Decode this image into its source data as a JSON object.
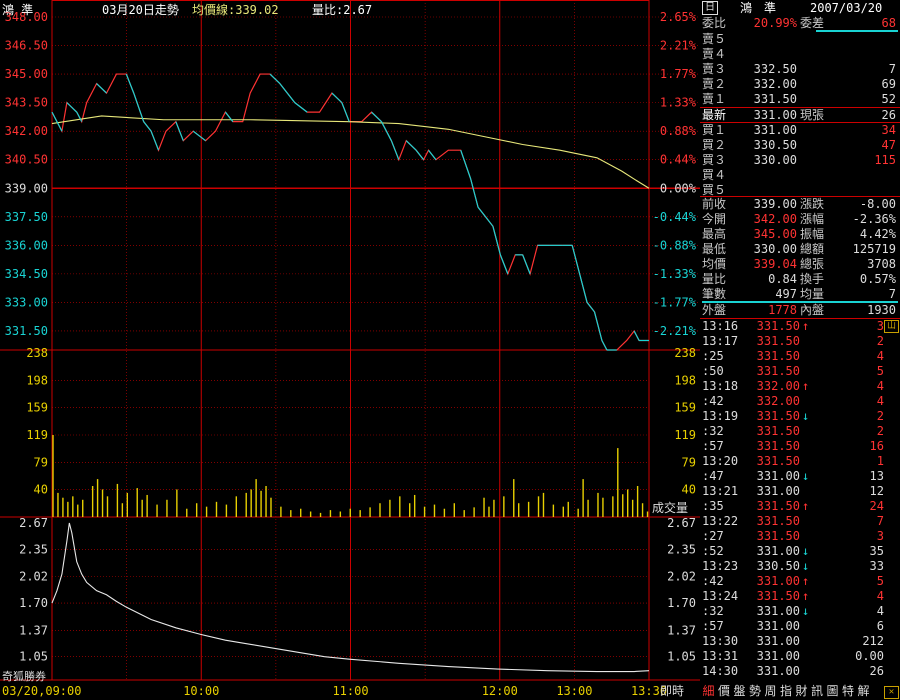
{
  "header": {
    "stock_name": "鴻 準",
    "date_label": "03月20日走勢",
    "avg_label": "均價線:339.02",
    "ratio_label": "量比:2.67"
  },
  "panel_icon": "日",
  "volume_label": "成交量",
  "time_label": "即時",
  "brand_label": "奇狐勝券",
  "chart_data": {
    "type": "line",
    "price_ticks": [
      "348.00",
      "346.50",
      "345.00",
      "343.50",
      "342.00",
      "340.50",
      "339.00",
      "337.50",
      "336.00",
      "334.50",
      "333.00",
      "331.50"
    ],
    "pct_ticks": [
      "2.65%",
      "2.21%",
      "1.77%",
      "1.33%",
      "0.88%",
      "0.44%",
      "0.00%",
      "-0.44%",
      "-0.88%",
      "-1.33%",
      "-1.77%",
      "-2.21%"
    ],
    "price_range": [
      330.5,
      348.0
    ],
    "prev_close": 339.0,
    "volume_ticks": [
      "238",
      "198",
      "159",
      "119",
      "79",
      "40"
    ],
    "volume_max": 238,
    "ratio_ticks": [
      "2.67",
      "2.35",
      "2.02",
      "1.70",
      "1.37",
      "1.05"
    ],
    "ratio_range": [
      0.84,
      2.67
    ],
    "x_ticks": [
      "03/20,09:00",
      "10:00",
      "11:00",
      "12:00",
      "13:00",
      "13:30"
    ],
    "price_series": [
      [
        0,
        343.0
      ],
      [
        4,
        342.0
      ],
      [
        6,
        343.5
      ],
      [
        10,
        343.0
      ],
      [
        12,
        342.5
      ],
      [
        14,
        343.5
      ],
      [
        18,
        344.5
      ],
      [
        22,
        344.0
      ],
      [
        26,
        345.0
      ],
      [
        30,
        345.0
      ],
      [
        33,
        344.0
      ],
      [
        37,
        342.5
      ],
      [
        40,
        342.0
      ],
      [
        43,
        341.0
      ],
      [
        46,
        342.0
      ],
      [
        50,
        342.5
      ],
      [
        53,
        341.5
      ],
      [
        57,
        342.0
      ],
      [
        62,
        341.5
      ],
      [
        66,
        342.0
      ],
      [
        70,
        343.0
      ],
      [
        73,
        342.5
      ],
      [
        77,
        342.5
      ],
      [
        80,
        344.0
      ],
      [
        84,
        345.0
      ],
      [
        88,
        345.0
      ],
      [
        92,
        344.5
      ],
      [
        95,
        344.0
      ],
      [
        98,
        343.5
      ],
      [
        103,
        343.0
      ],
      [
        108,
        343.0
      ],
      [
        113,
        344.0
      ],
      [
        117,
        343.5
      ],
      [
        120,
        342.5
      ],
      [
        125,
        342.5
      ],
      [
        129,
        343.0
      ],
      [
        133,
        342.5
      ],
      [
        137,
        341.5
      ],
      [
        140,
        340.5
      ],
      [
        143,
        341.5
      ],
      [
        147,
        341.0
      ],
      [
        150,
        340.5
      ],
      [
        152,
        341.0
      ],
      [
        155,
        340.5
      ],
      [
        160,
        341.0
      ],
      [
        165,
        341.0
      ],
      [
        169,
        339.5
      ],
      [
        172,
        338.0
      ],
      [
        175,
        337.5
      ],
      [
        178,
        337.0
      ],
      [
        181,
        335.5
      ],
      [
        184,
        334.5
      ],
      [
        187,
        335.5
      ],
      [
        190,
        335.5
      ],
      [
        193,
        334.5
      ],
      [
        196,
        336.0
      ],
      [
        201,
        336.0
      ],
      [
        206,
        336.0
      ],
      [
        210,
        336.0
      ],
      [
        213,
        334.5
      ],
      [
        216,
        333.0
      ],
      [
        219,
        332.5
      ],
      [
        222,
        331.0
      ],
      [
        224,
        330.5
      ],
      [
        228,
        330.5
      ],
      [
        232,
        331.0
      ],
      [
        235,
        331.5
      ],
      [
        237,
        331.0
      ],
      [
        240,
        331.0
      ],
      [
        241,
        331.0
      ]
    ],
    "avg_series": [
      [
        0,
        342.4
      ],
      [
        20,
        342.8
      ],
      [
        45,
        342.6
      ],
      [
        80,
        342.6
      ],
      [
        120,
        342.5
      ],
      [
        140,
        342.4
      ],
      [
        160,
        342.1
      ],
      [
        175,
        341.7
      ],
      [
        190,
        341.3
      ],
      [
        205,
        341.0
      ],
      [
        220,
        340.6
      ],
      [
        230,
        339.9
      ],
      [
        236,
        339.4
      ],
      [
        241,
        339.0
      ]
    ],
    "volume_series": [
      [
        0,
        119
      ],
      [
        2,
        35
      ],
      [
        4,
        28
      ],
      [
        6,
        22
      ],
      [
        8,
        30
      ],
      [
        10,
        18
      ],
      [
        12,
        25
      ],
      [
        16,
        45
      ],
      [
        18,
        55
      ],
      [
        20,
        40
      ],
      [
        22,
        30
      ],
      [
        26,
        48
      ],
      [
        28,
        20
      ],
      [
        30,
        35
      ],
      [
        34,
        42
      ],
      [
        36,
        25
      ],
      [
        38,
        32
      ],
      [
        42,
        18
      ],
      [
        46,
        25
      ],
      [
        50,
        40
      ],
      [
        54,
        12
      ],
      [
        58,
        20
      ],
      [
        62,
        15
      ],
      [
        66,
        22
      ],
      [
        70,
        18
      ],
      [
        74,
        30
      ],
      [
        78,
        35
      ],
      [
        80,
        40
      ],
      [
        82,
        55
      ],
      [
        84,
        38
      ],
      [
        86,
        45
      ],
      [
        88,
        28
      ],
      [
        92,
        15
      ],
      [
        96,
        10
      ],
      [
        100,
        12
      ],
      [
        104,
        8
      ],
      [
        108,
        6
      ],
      [
        112,
        10
      ],
      [
        116,
        8
      ],
      [
        120,
        12
      ],
      [
        124,
        10
      ],
      [
        128,
        14
      ],
      [
        132,
        20
      ],
      [
        136,
        25
      ],
      [
        140,
        30
      ],
      [
        144,
        20
      ],
      [
        146,
        32
      ],
      [
        150,
        15
      ],
      [
        154,
        18
      ],
      [
        158,
        12
      ],
      [
        162,
        20
      ],
      [
        166,
        10
      ],
      [
        170,
        14
      ],
      [
        174,
        28
      ],
      [
        176,
        15
      ],
      [
        178,
        25
      ],
      [
        182,
        30
      ],
      [
        186,
        55
      ],
      [
        188,
        20
      ],
      [
        192,
        22
      ],
      [
        196,
        30
      ],
      [
        198,
        35
      ],
      [
        202,
        18
      ],
      [
        206,
        15
      ],
      [
        208,
        22
      ],
      [
        212,
        12
      ],
      [
        214,
        55
      ],
      [
        216,
        25
      ],
      [
        220,
        35
      ],
      [
        222,
        28
      ],
      [
        226,
        30
      ],
      [
        228,
        100
      ],
      [
        230,
        33
      ],
      [
        232,
        40
      ],
      [
        234,
        25
      ],
      [
        236,
        45
      ],
      [
        238,
        20
      ],
      [
        240,
        8
      ]
    ],
    "ratio_series": [
      [
        0,
        1.7
      ],
      [
        2,
        1.85
      ],
      [
        4,
        2.05
      ],
      [
        6,
        2.45
      ],
      [
        7,
        2.67
      ],
      [
        8,
        2.55
      ],
      [
        10,
        2.2
      ],
      [
        12,
        2.05
      ],
      [
        14,
        1.95
      ],
      [
        18,
        1.85
      ],
      [
        22,
        1.8
      ],
      [
        26,
        1.72
      ],
      [
        30,
        1.65
      ],
      [
        40,
        1.5
      ],
      [
        50,
        1.4
      ],
      [
        60,
        1.32
      ],
      [
        70,
        1.25
      ],
      [
        80,
        1.2
      ],
      [
        90,
        1.15
      ],
      [
        100,
        1.1
      ],
      [
        110,
        1.05
      ],
      [
        120,
        1.02
      ],
      [
        140,
        0.97
      ],
      [
        160,
        0.93
      ],
      [
        180,
        0.9
      ],
      [
        200,
        0.88
      ],
      [
        220,
        0.87
      ],
      [
        235,
        0.87
      ],
      [
        241,
        0.88
      ]
    ]
  },
  "quote": {
    "title": "鴻　準",
    "date": "2007/03/20",
    "weibi_label": "委比",
    "weibi_value": "20.99%",
    "weicha_label": "委差",
    "weicha_value": "68",
    "asks": [
      {
        "label": "賣５",
        "price": "",
        "vol": ""
      },
      {
        "label": "賣４",
        "price": "",
        "vol": ""
      },
      {
        "label": "賣３",
        "price": "332.50",
        "vol": "7"
      },
      {
        "label": "賣２",
        "price": "332.00",
        "vol": "69"
      },
      {
        "label": "賣１",
        "price": "331.50",
        "vol": "52"
      }
    ],
    "last_label": "最新",
    "last_value": "331.00",
    "cur_label": "現張",
    "cur_value": "26",
    "bids": [
      {
        "label": "買１",
        "price": "331.00",
        "vol": "34"
      },
      {
        "label": "買２",
        "price": "330.50",
        "vol": "47"
      },
      {
        "label": "買３",
        "price": "330.00",
        "vol": "115"
      },
      {
        "label": "買４",
        "price": "",
        "vol": ""
      },
      {
        "label": "買５",
        "price": "",
        "vol": ""
      }
    ],
    "stats": [
      {
        "l1": "前收",
        "v1": "339.00",
        "c1": "#dddddd",
        "l2": "漲跌",
        "v2": "-8.00",
        "c2": "#dddddd"
      },
      {
        "l1": "今開",
        "v1": "342.00",
        "c1": "#ff3333",
        "l2": "漲幅",
        "v2": "-2.36%",
        "c2": "#dddddd"
      },
      {
        "l1": "最高",
        "v1": "345.00",
        "c1": "#ff3333",
        "l2": "振幅",
        "v2": "4.42%",
        "c2": "#dddddd"
      },
      {
        "l1": "最低",
        "v1": "330.00",
        "c1": "#dddddd",
        "l2": "總額",
        "v2": "125719",
        "c2": "#dddddd"
      },
      {
        "l1": "均價",
        "v1": "339.04",
        "c1": "#ff3333",
        "l2": "總張",
        "v2": "3708",
        "c2": "#dddddd"
      },
      {
        "l1": "量比",
        "v1": "0.84",
        "c1": "#dddddd",
        "l2": "換手",
        "v2": "0.57%",
        "c2": "#dddddd"
      },
      {
        "l1": "筆數",
        "v1": "497",
        "c1": "#dddddd",
        "l2": "均量",
        "v2": "7",
        "c2": "#dddddd"
      }
    ],
    "outer_label": "外盤",
    "outer_value": "1778",
    "inner_label": "內盤",
    "inner_value": "1930"
  },
  "ticks": [
    {
      "time": "13:16",
      "price": "331.50",
      "color": "#ff3333",
      "arrow": "↑",
      "vol": "3"
    },
    {
      "time": "13:17",
      "price": "331.50",
      "color": "#ff3333",
      "arrow": "",
      "vol": "2"
    },
    {
      "time": ":25",
      "price": "331.50",
      "color": "#ff3333",
      "arrow": "",
      "vol": "4"
    },
    {
      "time": ":50",
      "price": "331.50",
      "color": "#ff3333",
      "arrow": "",
      "vol": "5"
    },
    {
      "time": "13:18",
      "price": "332.00",
      "color": "#ff3333",
      "arrow": "↑",
      "vol": "4"
    },
    {
      "time": ":42",
      "price": "332.00",
      "color": "#ff3333",
      "arrow": "",
      "vol": "4"
    },
    {
      "time": "13:19",
      "price": "331.50",
      "color": "#ff3333",
      "arrow": "↓",
      "vol": "2"
    },
    {
      "time": ":32",
      "price": "331.50",
      "color": "#ff3333",
      "arrow": "",
      "vol": "2"
    },
    {
      "time": ":57",
      "price": "331.50",
      "color": "#ff3333",
      "arrow": "",
      "vol": "16"
    },
    {
      "time": "13:20",
      "price": "331.50",
      "color": "#ff3333",
      "arrow": "",
      "vol": "1"
    },
    {
      "time": ":47",
      "price": "331.00",
      "color": "#dddddd",
      "arrow": "↓",
      "vol": "13"
    },
    {
      "time": "13:21",
      "price": "331.00",
      "color": "#dddddd",
      "arrow": "",
      "vol": "12"
    },
    {
      "time": ":35",
      "price": "331.50",
      "color": "#ff3333",
      "arrow": "↑",
      "vol": "24"
    },
    {
      "time": "13:22",
      "price": "331.50",
      "color": "#ff3333",
      "arrow": "",
      "vol": "7"
    },
    {
      "time": ":27",
      "price": "331.50",
      "color": "#ff3333",
      "arrow": "",
      "vol": "3"
    },
    {
      "time": ":52",
      "price": "331.00",
      "color": "#dddddd",
      "arrow": "↓",
      "vol": "35"
    },
    {
      "time": "13:23",
      "price": "330.50",
      "color": "#dddddd",
      "arrow": "↓",
      "vol": "33"
    },
    {
      "time": ":42",
      "price": "331.00",
      "color": "#ff3333",
      "arrow": "↑",
      "vol": "5"
    },
    {
      "time": "13:24",
      "price": "331.50",
      "color": "#ff3333",
      "arrow": "↑",
      "vol": "4"
    },
    {
      "time": ":32",
      "price": "331.00",
      "color": "#dddddd",
      "arrow": "↓",
      "vol": "4"
    },
    {
      "time": ":57",
      "price": "331.00",
      "color": "#dddddd",
      "arrow": "",
      "vol": "6"
    },
    {
      "time": "13:30",
      "price": "331.00",
      "color": "#dddddd",
      "arrow": "",
      "vol": "212"
    },
    {
      "time": "13:31",
      "price": "331.00",
      "color": "#dddddd",
      "arrow": "",
      "vol": "0.00"
    },
    {
      "time": "14:30",
      "price": "331.00",
      "color": "#dddddd",
      "arrow": "",
      "vol": "26"
    }
  ],
  "tabs": [
    "細",
    "價",
    "盤",
    "勢",
    "周",
    "指",
    "財",
    "訊",
    "圖",
    "特",
    "解"
  ]
}
